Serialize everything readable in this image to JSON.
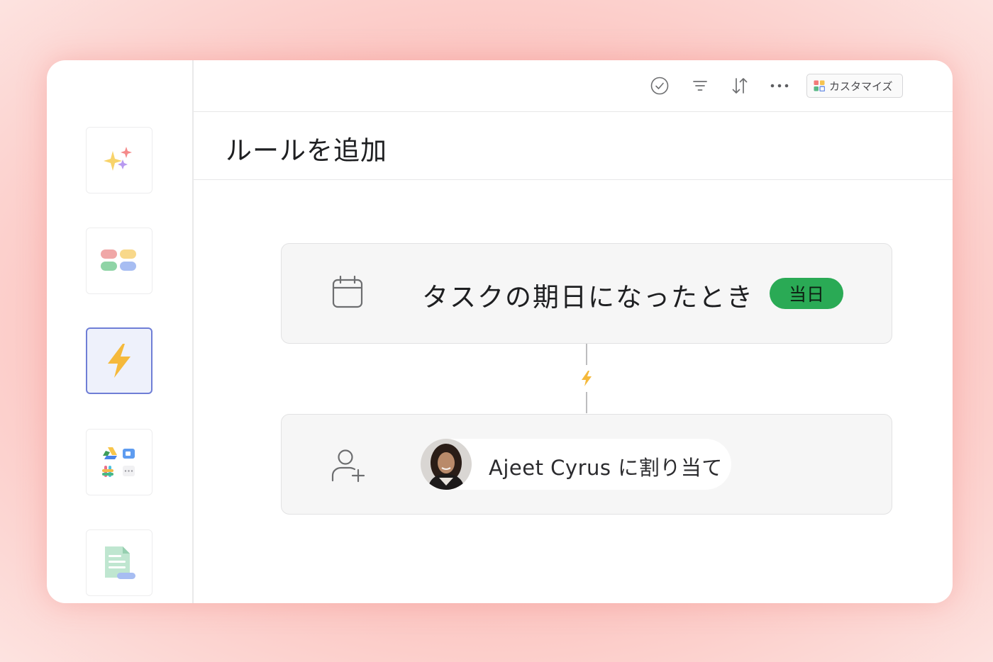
{
  "toolbar": {
    "customize_label": "カスタマイズ",
    "icons": [
      "check-circle-icon",
      "filter-icon",
      "sort-icon",
      "more-icon",
      "customize-grid-icon"
    ]
  },
  "sidebar": {
    "items": [
      {
        "icon": "sparkles-icon",
        "active": false
      },
      {
        "icon": "fields-icon",
        "active": false
      },
      {
        "icon": "lightning-bolt-icon",
        "active": true
      },
      {
        "icon": "integrations-icon",
        "active": false
      },
      {
        "icon": "document-icon",
        "active": false
      }
    ]
  },
  "page": {
    "title": "ルールを追加"
  },
  "rule": {
    "trigger_text": "タスクの期日になったとき",
    "trigger_badge": "当日",
    "action_text": "Ajeet Cyrus に割り当て"
  },
  "colors": {
    "accent_green": "#2aaa55",
    "active_border": "#6f7ed6",
    "bolt_yellow": "#f5b93b"
  }
}
